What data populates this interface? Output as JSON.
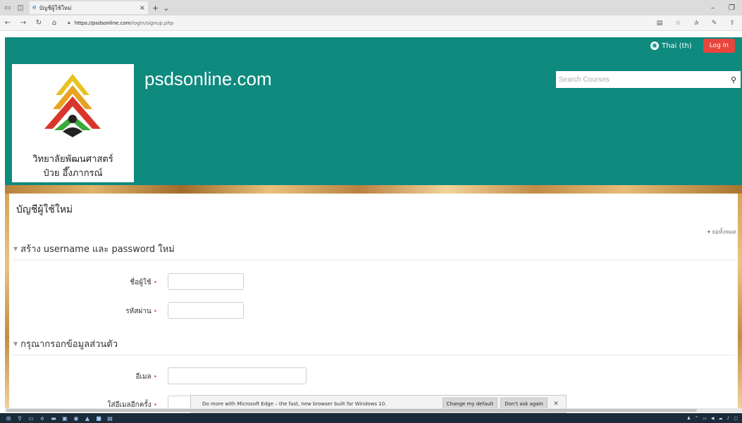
{
  "browser": {
    "tab_title": "บัญชีผู้ใช้ใหม่",
    "url_host": "https://psdsonline.com",
    "url_path": "/login/signup.php"
  },
  "topnav": {
    "language": "Thai (th)",
    "login_label": "Log In"
  },
  "header": {
    "site_title": "psdsonline.com",
    "search_placeholder": "Search Courses",
    "logo_line1": "วิทยาลัยพัฒนศาสตร์",
    "logo_line2": "ป๋วย อึ๊งภากรณ์"
  },
  "form": {
    "page_heading": "บัญชีผู้ใช้ใหม่",
    "collapse_all": "ย่อทั้งหมด",
    "section1_title": "สร้าง username และ password ใหม่",
    "username_label": "ชื่อผู้ใช้",
    "password_label": "รหัสผ่าน",
    "section2_title": "กรุณากรอกข้อมูลส่วนตัว",
    "email_label": "อีเมล",
    "email_again_label": "ใส่อีเมลอีกครั้ง",
    "required_mark": "•"
  },
  "notification": {
    "message": "Do more with Microsoft Edge – the fast, new browser built for Windows 10.",
    "change_default": "Change my default",
    "dont_ask": "Don't ask again"
  },
  "colors": {
    "brand_teal": "#0e8a7e",
    "login_red": "#e8453c"
  }
}
